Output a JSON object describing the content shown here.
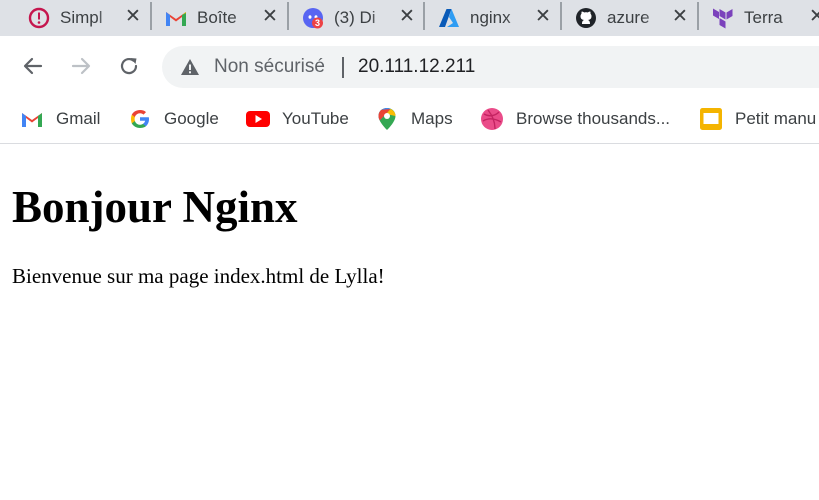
{
  "tabs": [
    {
      "title": "Simpl",
      "icon": "opera-circle-icon"
    },
    {
      "title": "Boîte",
      "icon": "gmail-icon"
    },
    {
      "title": "(3) Di",
      "icon": "discord-icon",
      "badge": "3"
    },
    {
      "title": "nginx",
      "icon": "azure-icon"
    },
    {
      "title": "azure",
      "icon": "github-icon"
    },
    {
      "title": "Terra",
      "icon": "terraform-icon"
    }
  ],
  "close_glyph": "✕",
  "omnibox": {
    "security_text": "Non sécurisé",
    "url": "20.111.12.211"
  },
  "bookmarks": [
    {
      "label": "Gmail",
      "icon": "gmail-icon"
    },
    {
      "label": "Google",
      "icon": "google-icon"
    },
    {
      "label": "YouTube",
      "icon": "youtube-icon"
    },
    {
      "label": "Maps",
      "icon": "maps-icon"
    },
    {
      "label": "Browse thousands...",
      "icon": "dribbble-icon"
    },
    {
      "label": "Petit manu",
      "icon": "slides-icon"
    }
  ],
  "page": {
    "heading": "Bonjour Nginx",
    "paragraph": "Bienvenue sur ma page index.html de Lylla!"
  },
  "colors": {
    "tabstrip_bg": "#dee1e6",
    "omnibox_bg": "#f1f3f4",
    "text_gray": "#3c4043"
  }
}
